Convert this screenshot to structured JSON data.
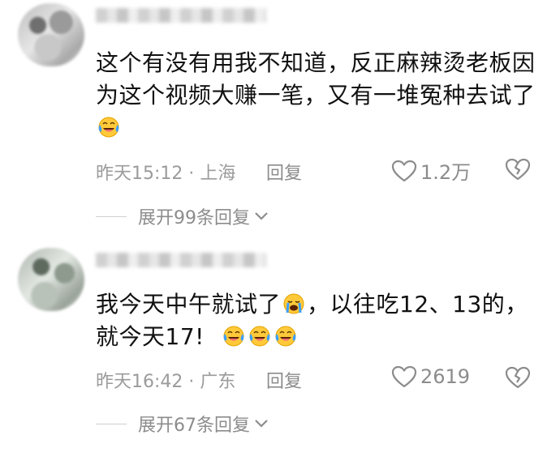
{
  "comments": [
    {
      "text_parts": [
        "这个有没有用我不知道，反正麻辣烫老板因为这个视频大赚一笔，又有一堆冤种去试了"
      ],
      "time": "昨天15:12",
      "location": "上海",
      "reply_label": "回复",
      "likes": "1.2万",
      "expand_label": "展开99条回复",
      "emojis": [
        "laugh-cry-emoji"
      ]
    },
    {
      "text_a": "我今天中午就试了",
      "text_b": "，以往吃12、13的，就今天17!",
      "time": "昨天16:42",
      "location": "广东",
      "reply_label": "回复",
      "likes": "2619",
      "expand_label": "展开67条回复",
      "emojis": [
        "crying-emoji",
        "laugh-cry-emoji",
        "laugh-cry-emoji",
        "laugh-cry-emoji"
      ]
    }
  ],
  "separator": "·",
  "colors": {
    "text": "#111111",
    "meta": "#9b9b9b",
    "emoji_face": "#ffc93a",
    "tears": "#3aa0ff"
  }
}
